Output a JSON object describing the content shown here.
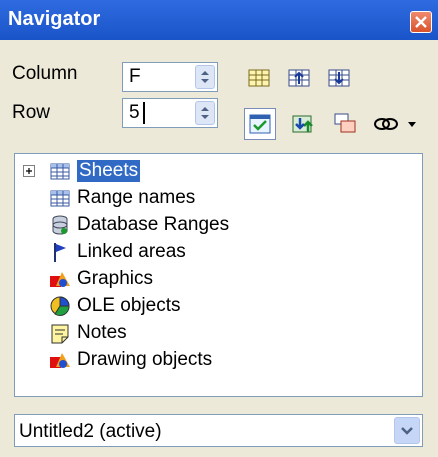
{
  "window": {
    "title": "Navigator"
  },
  "fields": {
    "column_label": "Column",
    "column_value": "F",
    "row_label": "Row",
    "row_value": "5"
  },
  "toolbar": {
    "buttons": [
      {
        "icon": "data-range-icon"
      },
      {
        "icon": "start-icon"
      },
      {
        "icon": "end-icon"
      },
      {
        "icon": "contents-toggle-icon"
      },
      {
        "icon": "scenarios-icon"
      },
      {
        "icon": "drag-mode-icon"
      },
      {
        "icon": "link-icon"
      },
      {
        "icon": "dropdown-arrow-icon"
      }
    ]
  },
  "tree": {
    "items": [
      {
        "label": "Sheets",
        "icon": "sheets-icon",
        "selected": true
      },
      {
        "label": "Range names",
        "icon": "range-names-icon"
      },
      {
        "label": "Database Ranges",
        "icon": "database-icon"
      },
      {
        "label": "Linked areas",
        "icon": "linked-areas-icon"
      },
      {
        "label": "Graphics",
        "icon": "graphics-icon"
      },
      {
        "label": "OLE objects",
        "icon": "ole-objects-icon"
      },
      {
        "label": "Notes",
        "icon": "notes-icon"
      },
      {
        "label": "Drawing objects",
        "icon": "drawing-objects-icon"
      }
    ]
  },
  "document": {
    "selected": "Untitled2 (active)"
  }
}
